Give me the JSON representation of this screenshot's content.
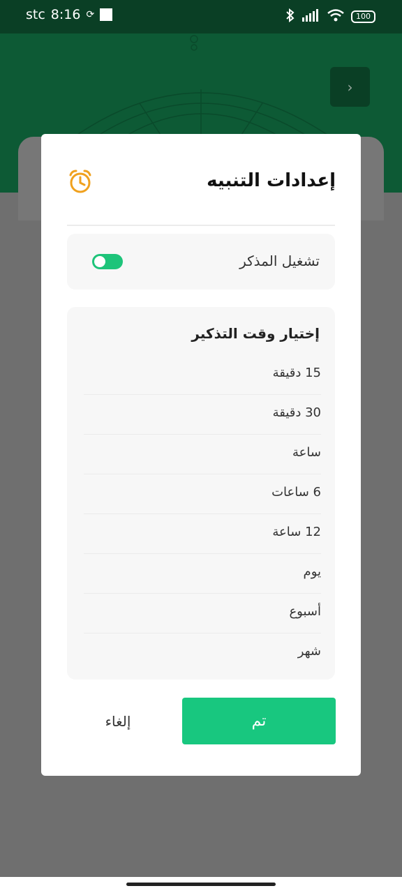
{
  "status": {
    "carrier": "stc",
    "time": "8:16",
    "battery": "100"
  },
  "dialog": {
    "title": "إعدادات التنبيه",
    "toggle_label": "تشغيل المذكر",
    "toggle_on": true,
    "options_title": "إختيار وقت التذكير",
    "options": [
      "15 دقيقة",
      "30 دقيقة",
      "ساعة",
      "6 ساعات",
      "12 ساعة",
      "يوم",
      "أسبوع",
      "شهر"
    ],
    "done_label": "تم",
    "cancel_label": "إلغاء"
  },
  "colors": {
    "header_green": "#0d5a35",
    "accent": "#18c77f",
    "alarm_orange": "#f0a11e"
  },
  "icons": {
    "back": "chevron-right-icon",
    "alarm": "alarm-clock-icon"
  }
}
